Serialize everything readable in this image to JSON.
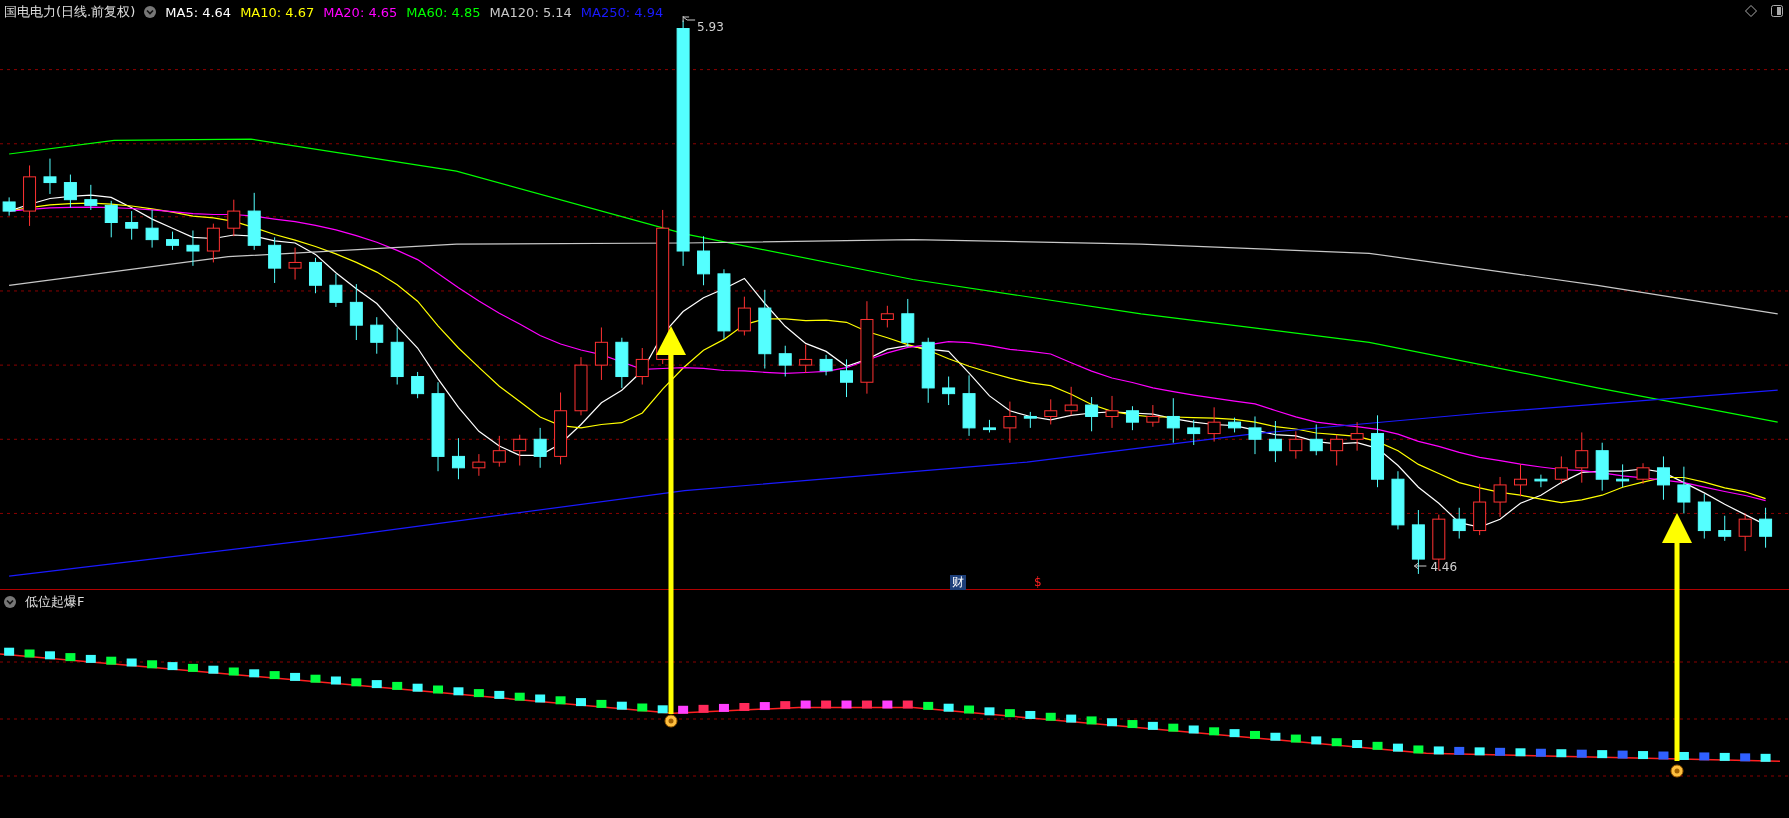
{
  "header": {
    "title": "国电电力(日线.前复权)",
    "averages": [
      {
        "label": "MA5: 4.64",
        "color": "#ffffff"
      },
      {
        "label": "MA10: 4.67",
        "color": "#ffff00"
      },
      {
        "label": "MA20: 4.65",
        "color": "#ff00ff"
      },
      {
        "label": "MA60: 4.85",
        "color": "#00ff00"
      },
      {
        "label": "MA120: 5.14",
        "color": "#c8c8c8"
      },
      {
        "label": "MA250: 4.94",
        "color": "#1a1aff"
      }
    ]
  },
  "price_labels": {
    "high": "5.93",
    "low": "4.46"
  },
  "markers": [
    {
      "kind": "finance",
      "text": "财"
    },
    {
      "kind": "dividend",
      "text": "$"
    }
  ],
  "indicator": {
    "title": "低位起爆F"
  }
}
